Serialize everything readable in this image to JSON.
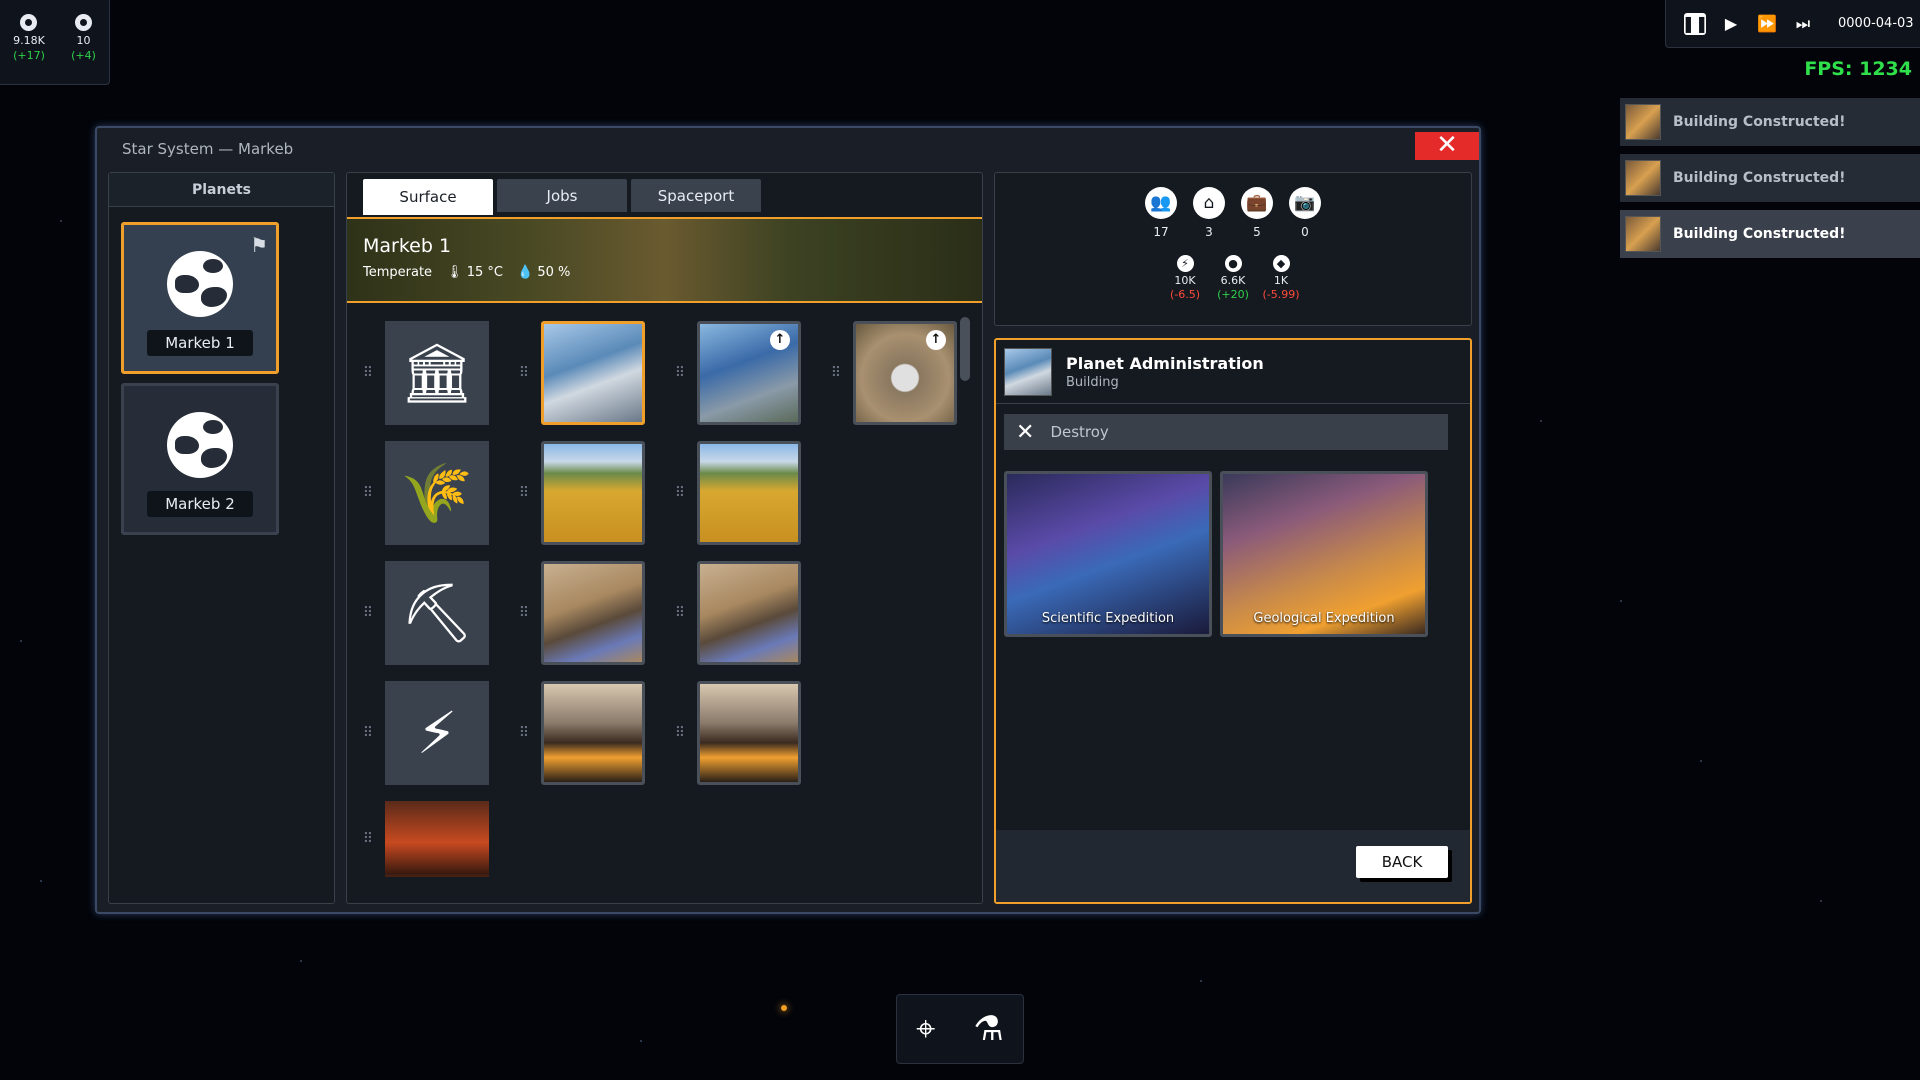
{
  "resources": [
    {
      "icon": "credits-icon",
      "value": "9.18K",
      "delta": "(+17)"
    },
    {
      "icon": "influence-icon",
      "value": "10",
      "delta": "(+4)"
    }
  ],
  "time_controls": {
    "date": "0000-04-03",
    "fps": "FPS: 1234"
  },
  "notifications": [
    {
      "text": "Building Constructed!"
    },
    {
      "text": "Building Constructed!"
    },
    {
      "text": "Building Constructed!"
    }
  ],
  "window": {
    "title": "Star System — Markeb",
    "close_label": "✕"
  },
  "planets": {
    "heading": "Planets",
    "items": [
      {
        "name": "Markeb 1",
        "selected": true
      },
      {
        "name": "Markeb 2",
        "selected": false
      }
    ]
  },
  "tabs": [
    {
      "label": "Surface",
      "active": true
    },
    {
      "label": "Jobs",
      "active": false
    },
    {
      "label": "Spaceport",
      "active": false
    }
  ],
  "planet_banner": {
    "name": "Markeb 1",
    "climate": "Temperate",
    "temperature": "15 °C",
    "humidity": "50 %"
  },
  "building_rows": [
    {
      "category": "administration",
      "buildings": [
        "planet-administration",
        "research-campus",
        "landing-pad"
      ]
    },
    {
      "category": "agriculture",
      "buildings": [
        "farm",
        "farm"
      ]
    },
    {
      "category": "mining",
      "buildings": [
        "mine",
        "mine"
      ]
    },
    {
      "category": "energy",
      "buildings": [
        "power-plant",
        "power-plant"
      ]
    },
    {
      "category": "hazard",
      "buildings": []
    }
  ],
  "planet_stats": {
    "primary": [
      {
        "icon": "population-icon",
        "value": "17"
      },
      {
        "icon": "housing-icon",
        "value": "3"
      },
      {
        "icon": "jobs-icon",
        "value": "5"
      },
      {
        "icon": "amenities-icon",
        "value": "0"
      }
    ],
    "secondary": [
      {
        "icon": "energy-icon",
        "value": "10K",
        "delta": "(-6.5)",
        "positive": false
      },
      {
        "icon": "food-icon",
        "value": "6.6K",
        "delta": "(+20)",
        "positive": true
      },
      {
        "icon": "minerals-icon",
        "value": "1K",
        "delta": "(-5.99)",
        "positive": false
      }
    ]
  },
  "detail": {
    "title": "Planet Administration",
    "subtitle": "Building",
    "destroy_label": "Destroy",
    "actions": [
      {
        "label": "Scientific Expedition"
      },
      {
        "label": "Geological Expedition"
      }
    ],
    "back_label": "BACK"
  },
  "colors": {
    "accent": "#f0a02a",
    "close": "#e52a2a",
    "positive": "#2fd04a",
    "negative": "#ff4a3a"
  }
}
